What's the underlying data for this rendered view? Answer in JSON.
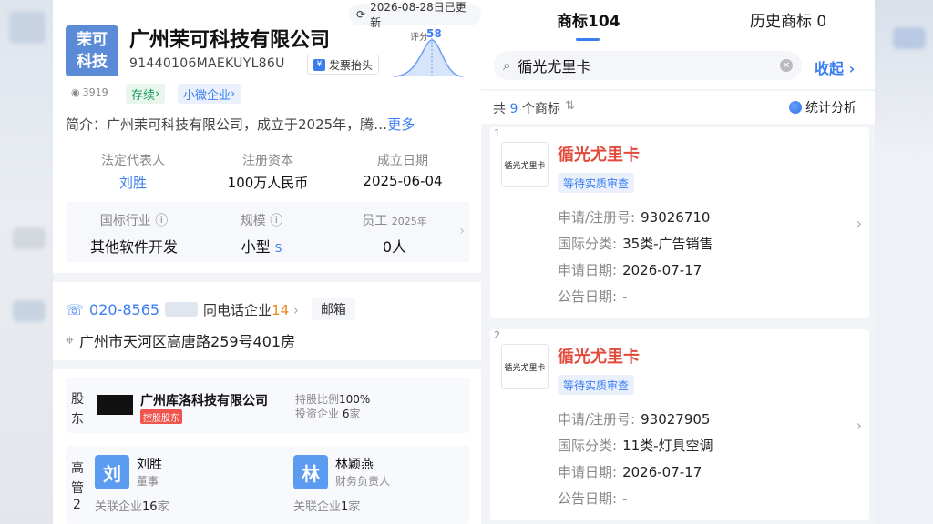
{
  "left": {
    "update_text": "2026-08-28日已更新",
    "logo_line1": "茉可",
    "logo_line2": "科技",
    "company_name": "广州茉可科技有限公司",
    "credit_code": "91440106MAEKUYL86U",
    "invoice_label": "发票抬头",
    "score_label": "评分",
    "score_value": "58",
    "views": "3919",
    "status_tag": "存续",
    "size_tag": "小微企业",
    "intro_text": "简介：广州茉可科技有限公司，成立于2025年，腾…",
    "intro_more": "更多",
    "facts": [
      {
        "key": "法定代表人",
        "value": "刘胜"
      },
      {
        "key": "注册资本",
        "value": "100万人民币"
      },
      {
        "key": "成立日期",
        "value": "2025-06-04"
      }
    ],
    "facts2": [
      {
        "key": "国标行业",
        "value": "其他软件开发"
      },
      {
        "key": "规模",
        "value": "小型",
        "suffix": "S"
      },
      {
        "key": "员工",
        "year": "2025年",
        "value": "0人"
      }
    ],
    "phone": "020-8565",
    "same_phone_label": "同电话企业",
    "same_phone_count": "14",
    "mail_label": "邮箱",
    "address": "广州市天河区高唐路259号401房",
    "shareholder": {
      "label": "股东",
      "name": "广州库洛科技有限公司",
      "badge": "控股股东",
      "ratio_label": "持股比例",
      "ratio_value": "100%",
      "invest_label": "投资企业",
      "invest_value": "6",
      "invest_unit": "家"
    },
    "execs": {
      "label": "高管",
      "count": "2",
      "people": [
        {
          "initial": "刘",
          "name": "刘胜",
          "role": "董事",
          "rel_label": "关联企业",
          "rel_value": "16",
          "rel_unit": "家"
        },
        {
          "initial": "林",
          "name": "林颖燕",
          "role": "财务负责人",
          "rel_label": "关联企业",
          "rel_value": "1",
          "rel_unit": "家"
        }
      ]
    }
  },
  "right": {
    "tab_active": "商标104",
    "tab_inactive": "历史商标 0",
    "search_value": "循光尤里卡",
    "collapse_label": "收起",
    "count_prefix": "共",
    "count_value": "9",
    "count_suffix": "个商标",
    "stats_label": "统计分析",
    "cards": [
      {
        "idx": "1",
        "thumb_text": "循光尤里卡",
        "name": "循光尤里卡",
        "status": "等待实质审查",
        "reg_label": "申请/注册号:",
        "reg_value": "93026710",
        "class_label": "国际分类:",
        "class_value": "35类-广告销售",
        "apply_label": "申请日期:",
        "apply_value": "2026-07-17",
        "pub_label": "公告日期:",
        "pub_value": "-"
      },
      {
        "idx": "2",
        "thumb_text": "循光尤里卡",
        "name": "循光尤里卡",
        "status": "等待实质审查",
        "reg_label": "申请/注册号:",
        "reg_value": "93027905",
        "class_label": "国际分类:",
        "class_value": "11类-灯具空调",
        "apply_label": "申请日期:",
        "apply_value": "2026-07-17",
        "pub_label": "公告日期:",
        "pub_value": "-"
      }
    ]
  },
  "colors": {
    "accent": "#3b7ef0",
    "trademark_name": "#e24a3b",
    "status_green": "#1a9a5a",
    "badge_red": "#f0544f"
  }
}
